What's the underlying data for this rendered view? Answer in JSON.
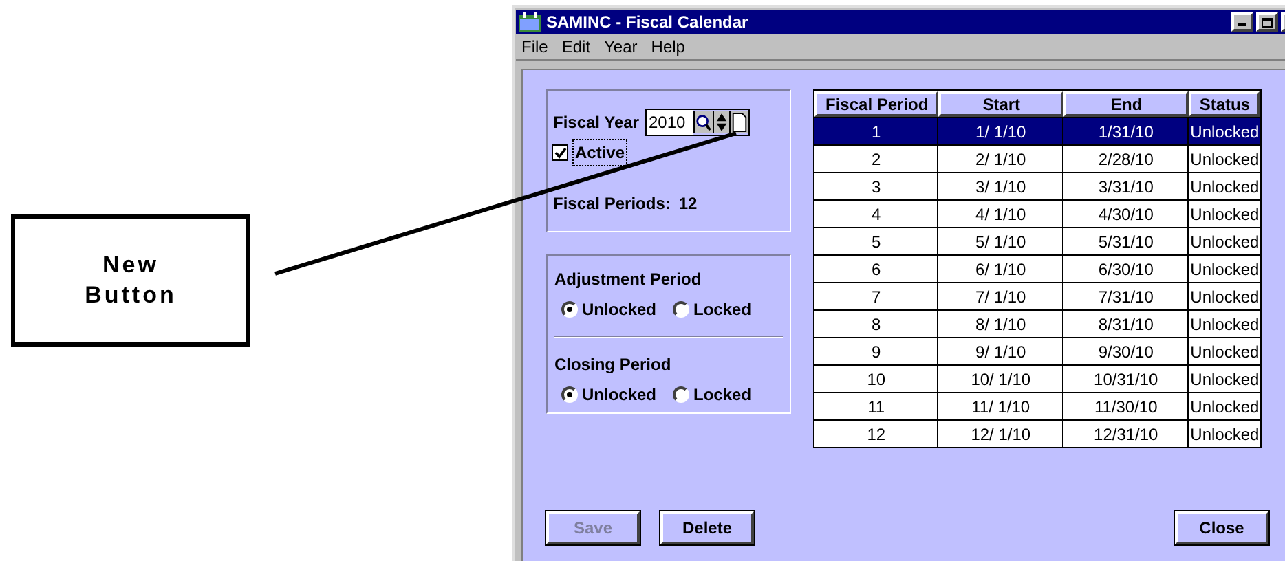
{
  "callout": {
    "lines": [
      "New",
      "Button"
    ]
  },
  "window": {
    "title": "SAMINC - Fiscal Calendar"
  },
  "menu": [
    "File",
    "Edit",
    "Year",
    "Help"
  ],
  "fiscal_year": {
    "label": "Fiscal Year",
    "value": "2010"
  },
  "active": {
    "label": "Active",
    "checked": true
  },
  "fiscal_periods": {
    "label": "Fiscal Periods:",
    "value": "12"
  },
  "period_groups": [
    {
      "title": "Adjustment Period",
      "options": [
        {
          "label": "Unlocked",
          "selected": true
        },
        {
          "label": "Locked",
          "selected": false
        }
      ]
    },
    {
      "title": "Closing Period",
      "options": [
        {
          "label": "Unlocked",
          "selected": true
        },
        {
          "label": "Locked",
          "selected": false
        }
      ]
    }
  ],
  "table": {
    "columns": [
      "Fiscal Period",
      "Start",
      "End",
      "Status"
    ],
    "rows": [
      {
        "cells": [
          "1",
          "1/ 1/10",
          "1/31/10",
          "Unlocked"
        ],
        "selected": true
      },
      {
        "cells": [
          "2",
          "2/ 1/10",
          "2/28/10",
          "Unlocked"
        ],
        "selected": false
      },
      {
        "cells": [
          "3",
          "3/ 1/10",
          "3/31/10",
          "Unlocked"
        ],
        "selected": false
      },
      {
        "cells": [
          "4",
          "4/ 1/10",
          "4/30/10",
          "Unlocked"
        ],
        "selected": false
      },
      {
        "cells": [
          "5",
          "5/ 1/10",
          "5/31/10",
          "Unlocked"
        ],
        "selected": false
      },
      {
        "cells": [
          "6",
          "6/ 1/10",
          "6/30/10",
          "Unlocked"
        ],
        "selected": false
      },
      {
        "cells": [
          "7",
          "7/ 1/10",
          "7/31/10",
          "Unlocked"
        ],
        "selected": false
      },
      {
        "cells": [
          "8",
          "8/ 1/10",
          "8/31/10",
          "Unlocked"
        ],
        "selected": false
      },
      {
        "cells": [
          "9",
          "9/ 1/10",
          "9/30/10",
          "Unlocked"
        ],
        "selected": false
      },
      {
        "cells": [
          "10",
          "10/ 1/10",
          "10/31/10",
          "Unlocked"
        ],
        "selected": false
      },
      {
        "cells": [
          "11",
          "11/ 1/10",
          "11/30/10",
          "Unlocked"
        ],
        "selected": false
      },
      {
        "cells": [
          "12",
          "12/ 1/10",
          "12/31/10",
          "Unlocked"
        ],
        "selected": false
      }
    ]
  },
  "buttons": [
    {
      "label": "Save",
      "disabled": true
    },
    {
      "label": "Delete",
      "disabled": false
    },
    {
      "label": "Close",
      "disabled": false
    }
  ]
}
